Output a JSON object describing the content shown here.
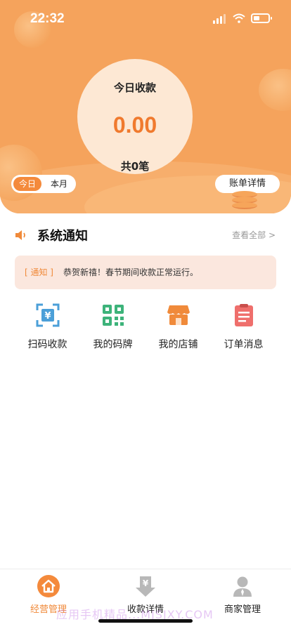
{
  "status_bar": {
    "time": "22:32"
  },
  "summary": {
    "title": "今日收款",
    "amount": "0.00",
    "count_text": "共0笔",
    "period_tabs": [
      {
        "label": "今日",
        "active": true
      },
      {
        "label": "本月",
        "active": false
      }
    ],
    "bill_detail_label": "账单详情"
  },
  "notice": {
    "title": "系统通知",
    "view_all": "查看全部 >",
    "tag": "[ 通知 ]",
    "message": "恭贺新禧！春节期间收款正常运行。"
  },
  "menu": [
    {
      "label": "扫码收款",
      "icon": "scan-yen-icon"
    },
    {
      "label": "我的码牌",
      "icon": "qr-code-icon"
    },
    {
      "label": "我的店铺",
      "icon": "store-icon"
    },
    {
      "label": "订单消息",
      "icon": "clipboard-icon"
    }
  ],
  "tabbar": [
    {
      "label": "经营管理",
      "icon": "home-icon",
      "active": true
    },
    {
      "label": "收款详情",
      "icon": "yen-down-icon",
      "active": false
    },
    {
      "label": "商家管理",
      "icon": "merchant-icon",
      "active": false
    }
  ],
  "watermark": "应用手机精品...MJSJXY.COM",
  "colors": {
    "accent": "#f48a3c",
    "header": "#f5a35c",
    "notice_bg": "#fbe7de"
  }
}
